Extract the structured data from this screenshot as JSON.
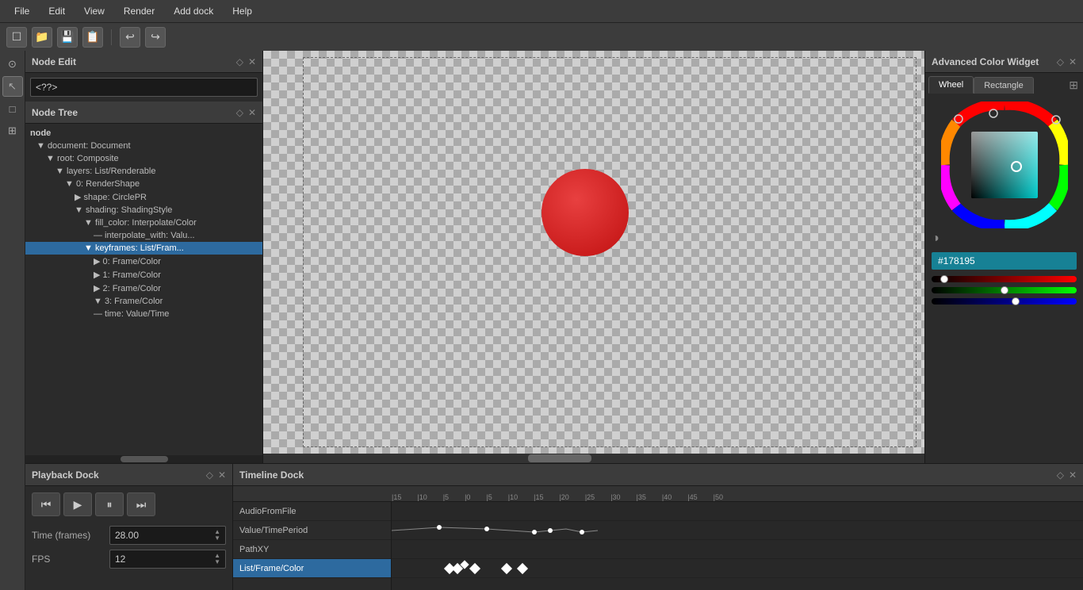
{
  "menubar": {
    "items": [
      "File",
      "Edit",
      "View",
      "Render",
      "Add dock",
      "Help"
    ]
  },
  "toolbar": {
    "buttons": [
      "new",
      "open",
      "save",
      "save-as",
      "undo",
      "redo"
    ]
  },
  "node_edit": {
    "title": "Node Edit",
    "input_value": "<??>",
    "input_placeholder": "<??>"
  },
  "node_tree": {
    "title": "Node Tree",
    "root_label": "node",
    "items": [
      {
        "label": "▼ document: Document",
        "indent": 1,
        "selected": false
      },
      {
        "label": "▼ root: Composite",
        "indent": 2,
        "selected": false
      },
      {
        "label": "▼ layers: List/Renderable",
        "indent": 3,
        "selected": false
      },
      {
        "label": "▼ 0: RenderShape",
        "indent": 4,
        "selected": false
      },
      {
        "label": "▶ shape: CirclePR",
        "indent": 5,
        "selected": false
      },
      {
        "label": "▼ shading: ShadingStyle",
        "indent": 5,
        "selected": false
      },
      {
        "label": "▼ fill_color: Interpolate/Color",
        "indent": 6,
        "selected": false
      },
      {
        "label": "— interpolate_with: Valu...",
        "indent": 7,
        "selected": false
      },
      {
        "label": "▼ keyframes: List/Fram...",
        "indent": 6,
        "selected": true
      },
      {
        "label": "▶ 0: Frame/Color",
        "indent": 7,
        "selected": false
      },
      {
        "label": "▶ 1: Frame/Color",
        "indent": 7,
        "selected": false
      },
      {
        "label": "▶ 2: Frame/Color",
        "indent": 7,
        "selected": false
      },
      {
        "label": "▼ 3: Frame/Color",
        "indent": 7,
        "selected": false
      },
      {
        "label": "— time: Value/Time",
        "indent": 7,
        "selected": false
      }
    ]
  },
  "color_widget": {
    "title": "Advanced Color Widget",
    "tabs": [
      "Wheel",
      "Rectangle"
    ],
    "active_tab": "Wheel",
    "hex_value": "#178195",
    "rgb": {
      "r": 23,
      "g": 129,
      "b": 149
    },
    "r_percent": 9,
    "g_percent": 50,
    "b_percent": 58
  },
  "playback": {
    "title": "Playback Dock",
    "time_label": "Time (frames)",
    "time_value": "28.00",
    "fps_label": "FPS",
    "fps_value": "12"
  },
  "timeline": {
    "title": "Timeline Dock",
    "ruler_marks": [
      "-15",
      "-10",
      "-5",
      "0",
      "5",
      "10",
      "15",
      "20",
      "25",
      "30",
      "35",
      "40",
      "45",
      "50"
    ],
    "tracks": [
      {
        "label": "AudioFromFile",
        "selected": false
      },
      {
        "label": "Value/TimePeriod",
        "selected": false
      },
      {
        "label": "PathXY",
        "selected": false
      },
      {
        "label": "List/Frame/Color",
        "selected": true
      }
    ]
  }
}
